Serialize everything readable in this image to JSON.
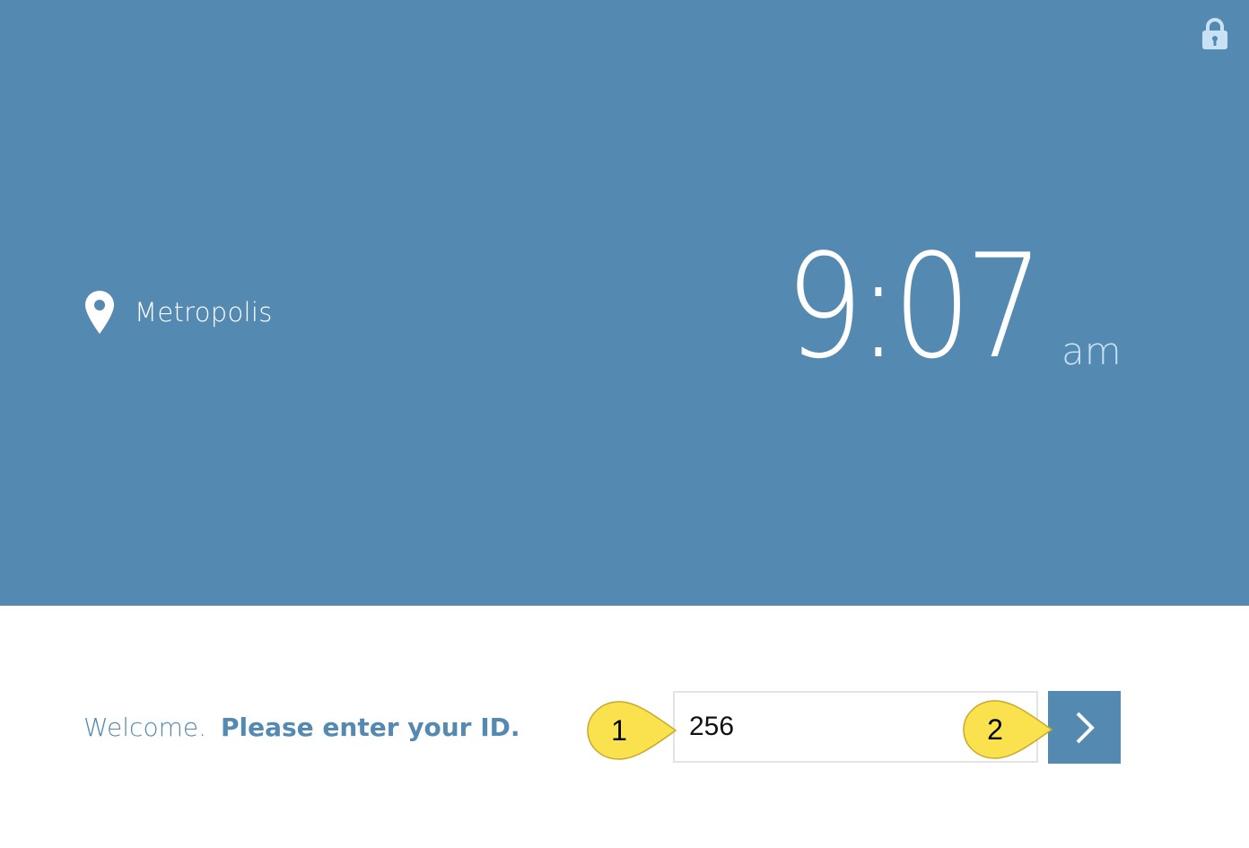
{
  "location": {
    "name": "Metropolis",
    "icon": "map-pin-icon"
  },
  "clock": {
    "time": "9:07",
    "period": "am"
  },
  "lock": {
    "icon": "lock-icon"
  },
  "welcome": {
    "greeting": "Welcome.",
    "prompt": "Please enter your ID."
  },
  "id_field": {
    "value": "256"
  },
  "submit": {
    "icon": "chevron-right-icon"
  },
  "callouts": [
    {
      "label": "1"
    },
    {
      "label": "2"
    }
  ],
  "colors": {
    "panel": "#5489b1",
    "ampm": "#c9e1f5",
    "lock": "#c9e1f5",
    "callout": "#f9e24d",
    "input_border": "#e3e3e3"
  }
}
